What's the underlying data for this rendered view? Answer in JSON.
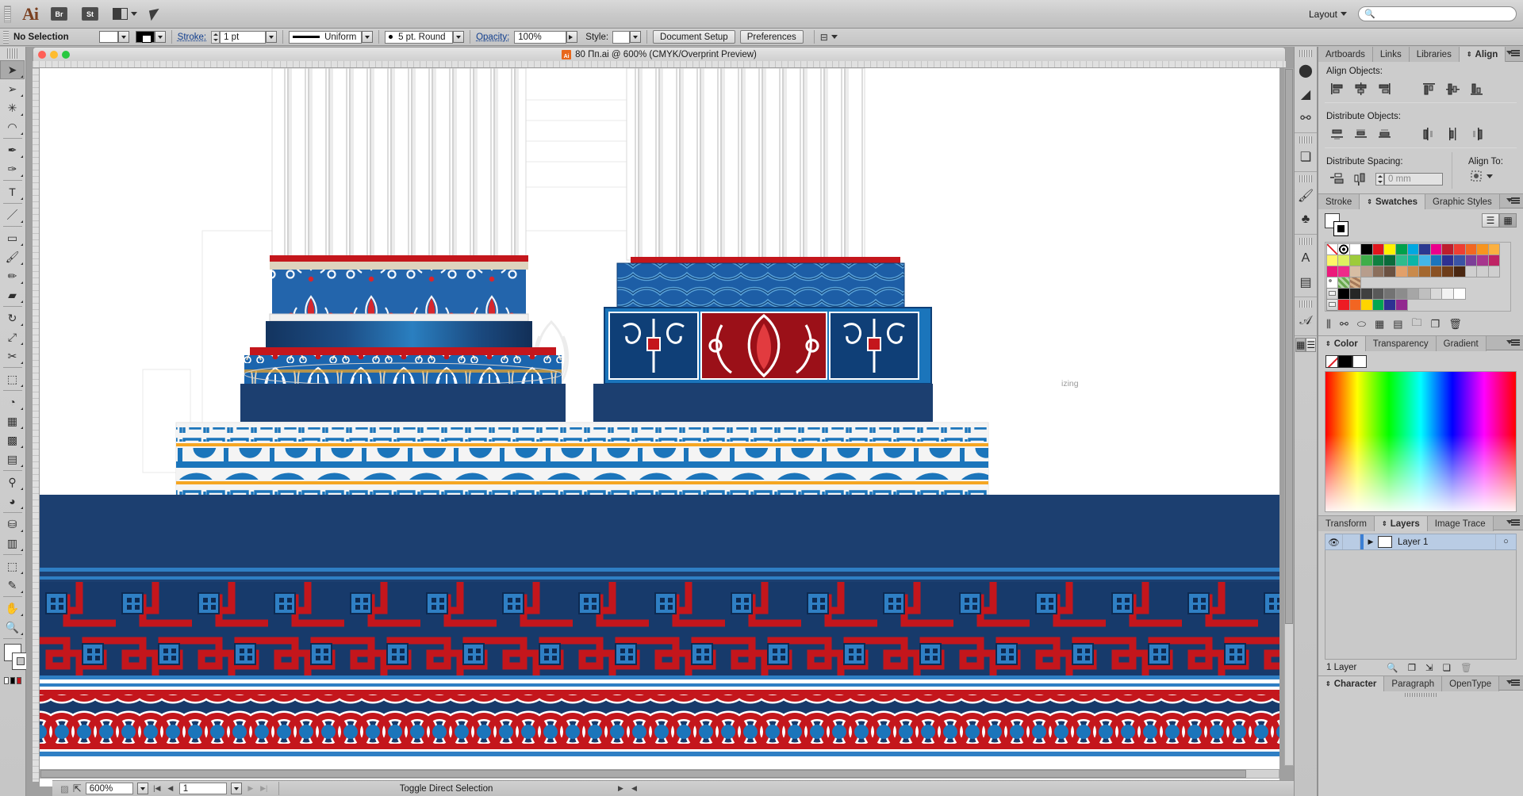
{
  "app": {
    "name": "Adobe Illustrator",
    "logo": "Ai",
    "bridge_label": "Br",
    "stock_label": "St",
    "arrange_icon": "arrange-documents-icon",
    "rocket_icon": "go-to-start-icon",
    "workspace_label": "Layout",
    "search_placeholder": "",
    "search_icon": "search-icon"
  },
  "control_bar": {
    "selection_status": "No Selection",
    "fill_label": "fill-swatch",
    "stroke_swatch_label": "stroke-swatch",
    "stroke_label": "Stroke:",
    "stroke_weight": "1 pt",
    "stroke_profile": "Uniform",
    "brush_definition": "5 pt. Round",
    "opacity_label": "Opacity:",
    "opacity_value": "100%",
    "style_label": "Style:",
    "document_setup": "Document Setup",
    "preferences": "Preferences",
    "align_icon": "align-options-icon"
  },
  "tools": {
    "grip": "toolbar-grip",
    "items": [
      {
        "name": "selection-tool",
        "glyph": "➤",
        "active": true
      },
      {
        "name": "direct-selection-tool",
        "glyph": "➢",
        "active": false
      },
      {
        "name": "magic-wand-tool",
        "glyph": "✳",
        "active": false
      },
      {
        "name": "lasso-tool",
        "glyph": "◠",
        "active": false
      },
      {
        "name": "pen-tool",
        "glyph": "✒",
        "active": false
      },
      {
        "name": "curvature-tool",
        "glyph": "✑",
        "active": false
      },
      {
        "name": "type-tool",
        "glyph": "T",
        "active": false
      },
      {
        "name": "line-segment-tool",
        "glyph": "／",
        "active": false
      },
      {
        "name": "rectangle-tool",
        "glyph": "▭",
        "active": false
      },
      {
        "name": "paintbrush-tool",
        "glyph": "🖌",
        "active": false
      },
      {
        "name": "pencil-tool",
        "glyph": "✏",
        "active": false
      },
      {
        "name": "eraser-tool",
        "glyph": "▰",
        "active": false
      },
      {
        "name": "rotate-tool",
        "glyph": "↻",
        "active": false
      },
      {
        "name": "scale-tool",
        "glyph": "⤢",
        "active": false
      },
      {
        "name": "width-tool",
        "glyph": "✂",
        "active": false
      },
      {
        "name": "free-transform-tool",
        "glyph": "⬚",
        "active": false
      },
      {
        "name": "shape-builder-tool",
        "glyph": "◔",
        "active": false
      },
      {
        "name": "perspective-grid-tool",
        "glyph": "▦",
        "active": false
      },
      {
        "name": "mesh-tool",
        "glyph": "▩",
        "active": false
      },
      {
        "name": "gradient-tool",
        "glyph": "▤",
        "active": false
      },
      {
        "name": "eyedropper-tool",
        "glyph": "⚲",
        "active": false
      },
      {
        "name": "blend-tool",
        "glyph": "◕",
        "active": false
      },
      {
        "name": "symbol-sprayer-tool",
        "glyph": "⛁",
        "active": false
      },
      {
        "name": "column-graph-tool",
        "glyph": "▥",
        "active": false
      },
      {
        "name": "artboard-tool",
        "glyph": "⬚",
        "active": false
      },
      {
        "name": "slice-tool",
        "glyph": "✎",
        "active": false
      },
      {
        "name": "hand-tool",
        "glyph": "✋",
        "active": false
      },
      {
        "name": "zoom-tool",
        "glyph": "🔍",
        "active": false
      }
    ],
    "fill_stroke": {
      "fill": "#ffffff",
      "stroke": "#ffffff"
    },
    "screen_modes": [
      "#ffffff",
      "#000000",
      "#ff2020"
    ]
  },
  "document": {
    "title": "80 Пп.ai @ 600% (CMYK/Overprint Preview)",
    "close_dot": "#ff5f57",
    "min_dot": "#febc2e",
    "max_dot": "#28c840",
    "zoom": "600%",
    "artboard_number": "1",
    "status_text": "Toggle Direct Selection"
  },
  "mini_dock": {
    "icons": [
      {
        "name": "brushes-panel-icon",
        "glyph": "⬤"
      },
      {
        "name": "gradient-panel-icon",
        "glyph": "◢"
      },
      {
        "name": "shape-builder-panel-icon",
        "glyph": "⚯"
      },
      {
        "name": "pathfinder-panel-icon",
        "glyph": "❏"
      },
      {
        "name": "brush-libraries-icon",
        "glyph": "🖌"
      },
      {
        "name": "symbols-panel-icon",
        "glyph": "♣"
      },
      {
        "name": "appearance-panel-icon",
        "glyph": "A"
      },
      {
        "name": "graphic-styles-icon",
        "glyph": "▤"
      },
      {
        "name": "character-panel-icon",
        "glyph": "𝒜"
      }
    ],
    "view_grid_icon": "grid-view-icon",
    "view_list_icon": "list-view-icon"
  },
  "align_panel": {
    "tabs": [
      {
        "label": "Artboards",
        "active": false
      },
      {
        "label": "Links",
        "active": false
      },
      {
        "label": "Libraries",
        "active": false
      },
      {
        "label": "Align",
        "active": true
      }
    ],
    "align_objects_label": "Align Objects:",
    "distribute_objects_label": "Distribute Objects:",
    "distribute_spacing_label": "Distribute Spacing:",
    "align_to_label": "Align To:",
    "spacing_value": "0 mm",
    "align_buttons": [
      "align-left-icon",
      "align-horizontal-center-icon",
      "align-right-icon",
      "align-top-icon",
      "align-vertical-center-icon",
      "align-bottom-icon"
    ],
    "distribute_buttons": [
      "distribute-top-icon",
      "distribute-vertical-center-icon",
      "distribute-bottom-icon",
      "distribute-left-icon",
      "distribute-horizontal-center-icon",
      "distribute-right-icon"
    ],
    "spacing_buttons": [
      "distribute-vertical-spacing-icon",
      "distribute-horizontal-spacing-icon"
    ],
    "align_to_icon": "align-to-selection-icon"
  },
  "swatches_panel": {
    "tabs": [
      {
        "label": "Stroke",
        "active": false
      },
      {
        "label": "Swatches",
        "active": true
      },
      {
        "label": "Graphic Styles",
        "active": false
      }
    ],
    "rows": [
      [
        "none",
        "registration",
        "#ffffff",
        "#000000",
        "#e0161d",
        "#fff200",
        "#00a14b",
        "#00a8e1",
        "#2b3990",
        "#ec008c",
        "#be1e2d",
        "#ee3e33",
        "#f26722",
        "#f7941e",
        "#fbb040"
      ],
      [
        "#fff568",
        "#ddf060",
        "#9dcb3b",
        "#3fae49",
        "#0f8040",
        "#0b6b3a",
        "#2fbc8c",
        "#0ab5a8",
        "#43b6e8",
        "#1b75bb",
        "#2e3192",
        "#3a53a4",
        "#7c3f98",
        "#a7368e",
        "#bf2364"
      ],
      [
        "#ec197b",
        "#ee2a8a",
        "#d7bda3",
        "#b79d8c",
        "#8b6f5c",
        "#6b5141",
        "#e2a06a",
        "#c98a4b",
        "#a4682f",
        "#8a5123",
        "#6e3d1a",
        "#4a2711",
        "#gradwhite",
        "#gradgold",
        "#patblue"
      ],
      [
        "pattern-dots",
        "pattern-leaf",
        "pattern-cork"
      ],
      [
        "folder",
        "#000000",
        "#262626",
        "#404040",
        "#595959",
        "#737373",
        "#8c8c8c",
        "#a6a6a6",
        "#bfbfbf",
        "#d9d9d9",
        "#f2f2f2",
        "#ffffff"
      ],
      [
        "folder",
        "#ed1c24",
        "#f26522",
        "#ffd400",
        "#00a651",
        "#2e3192",
        "#92278f"
      ]
    ],
    "footer_icons": [
      "swatch-libraries-icon",
      "show-spot-colors-icon",
      "color-group-icon",
      "swatch-options-icon",
      "list-options-icon",
      "new-color-group-icon",
      "new-swatch-icon",
      "delete-swatch-icon"
    ],
    "view_mode": "grid"
  },
  "color_panel": {
    "tabs": [
      {
        "label": "Color",
        "active": true
      },
      {
        "label": "Transparency",
        "active": false
      },
      {
        "label": "Gradient",
        "active": false
      }
    ],
    "none_swatch": "none",
    "fill_swatch": "#000000",
    "stroke_swatch": "#ffffff"
  },
  "layers_panel": {
    "tabs": [
      {
        "label": "Transform",
        "active": false
      },
      {
        "label": "Layers",
        "active": true
      },
      {
        "label": "Image Trace",
        "active": false
      }
    ],
    "layers": [
      {
        "name": "Layer 1",
        "visible": true,
        "locked": false,
        "selected": true,
        "color": "#3b7fd4"
      }
    ],
    "count_label": "1 Layer",
    "footer_icons": [
      "locate-object-icon",
      "make-clipping-mask-icon",
      "create-new-sublayer-icon",
      "create-new-layer-icon",
      "delete-layer-icon"
    ],
    "eye_icon": "eye-icon",
    "disclosure_icon": "triangle-right-icon",
    "target_icon": "target-circle-icon"
  },
  "type_panel": {
    "tabs": [
      {
        "label": "Character",
        "active": true
      },
      {
        "label": "Paragraph",
        "active": false
      },
      {
        "label": "OpenType",
        "active": false
      }
    ]
  },
  "artwork": {
    "description": "Greek classical column capitals with painted polychrome ornament and decorative meander, wave and guilloche border bands",
    "palette": {
      "navy": "#1c3f70",
      "deep_navy": "#173a6b",
      "blue": "#1b75bb",
      "mid_blue": "#2e6fad",
      "red": "#c4161c",
      "bright_red": "#d42027",
      "cream": "#ded3bd",
      "white": "#f4f4f4",
      "gold": "#f5a623",
      "light_blue": "#4a9fd8"
    },
    "bands": [
      {
        "name": "meander-band-top",
        "pattern": "greek-key"
      },
      {
        "name": "wave-band",
        "pattern": "vitruvian-wave"
      },
      {
        "name": "meander-band-bottom",
        "pattern": "greek-key"
      },
      {
        "name": "swastika-meander-band",
        "pattern": "greek-key-square"
      },
      {
        "name": "guilloche-band",
        "pattern": "interlaced-circles"
      }
    ]
  }
}
